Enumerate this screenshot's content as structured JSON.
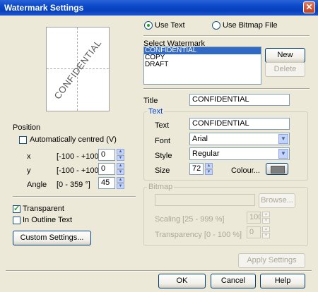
{
  "window": {
    "title": "Watermark Settings",
    "close_glyph": "✕"
  },
  "mode": {
    "use_text": "Use Text",
    "use_bitmap": "Use Bitmap File",
    "selected": "use_text"
  },
  "preview": {
    "watermark_text": "CONFIDENTIAL"
  },
  "select_watermark": {
    "label": "Select Watermark",
    "items": [
      "CONFIDENTIAL",
      "COPY",
      "DRAFT"
    ],
    "selected_index": 0,
    "new_label": "New",
    "delete_label": "Delete"
  },
  "title_field": {
    "label": "Title",
    "value": "CONFIDENTIAL"
  },
  "text_group": {
    "label": "Text",
    "text_label": "Text",
    "text_value": "CONFIDENTIAL",
    "font_label": "Font",
    "font_value": "Arial",
    "style_label": "Style",
    "style_value": "Regular",
    "size_label": "Size",
    "size_value": "72",
    "colour_label": "Colour...",
    "colour_hex": "#7d7d7d"
  },
  "bitmap_group": {
    "label": "Bitmap",
    "path_value": "",
    "browse_label": "Browse...",
    "scaling_label": "Scaling [25 - 999 %]",
    "scaling_value": "100",
    "transparency_label": "Transparency [0 - 100 %]",
    "transparency_value": "0"
  },
  "position": {
    "label": "Position",
    "auto_centred_label": "Automatically centred (V)",
    "auto_centred_checked": false,
    "x_label": "x",
    "x_range": "[-100 - +100]",
    "x_value": "0",
    "y_label": "y",
    "y_range": "[-100 - +100]",
    "y_value": "0",
    "angle_label": "Angle",
    "angle_range": "[0 - 359 °]",
    "angle_value": "45"
  },
  "options": {
    "transparent_label": "Transparent",
    "transparent_checked": true,
    "outline_label": "In Outline Text",
    "outline_checked": false,
    "custom_settings_label": "Custom Settings..."
  },
  "footer": {
    "apply_label": "Apply Settings",
    "ok_label": "OK",
    "cancel_label": "Cancel",
    "help_label": "Help"
  }
}
